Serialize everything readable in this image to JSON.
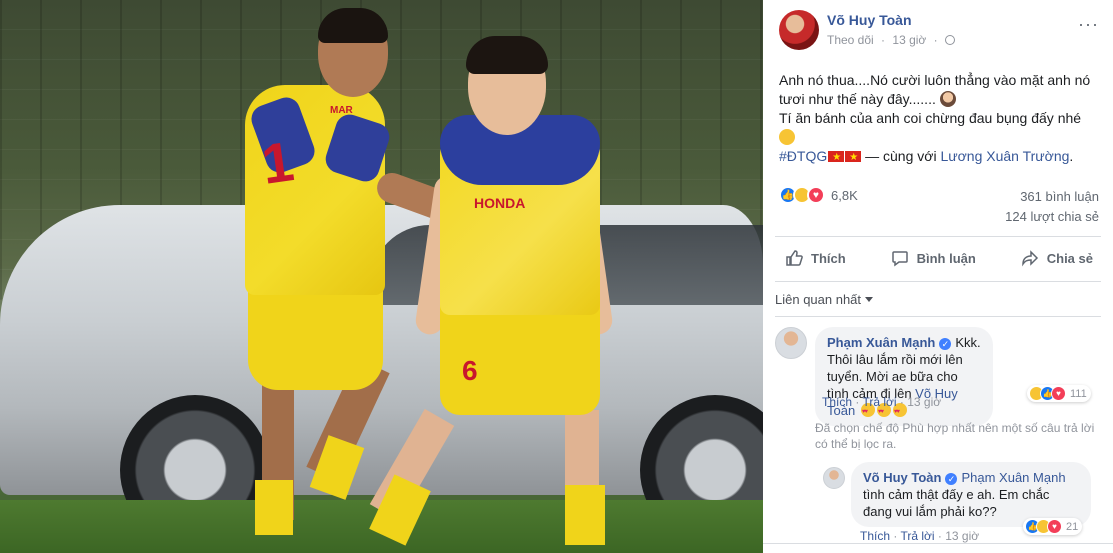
{
  "post": {
    "author": "Võ Huy Toàn",
    "follow_label": "Theo dõi",
    "time": "13 giờ",
    "more_label": "···",
    "text_line1": "Anh nó thua....Nó cười luôn thẳng vào mặt anh nó tươi như thế này đây.......",
    "text_line2": "Tí ăn bánh của anh coi chừng đau bụng đấy nhé",
    "hashtag": "#ĐTQG",
    "with_text": " — cùng với ",
    "tagged_person": "Lương Xuân Trường",
    "period": ".",
    "photo_jersey_number": "1",
    "photo_shorts_number": "6",
    "photo_brand": "HONDA",
    "photo_sleeve_text": "MAR"
  },
  "stats": {
    "reaction_count": "6,8K",
    "comments": "361 bình luận",
    "shares": "124 lượt chia sẻ"
  },
  "actions": {
    "like": "Thích",
    "comment": "Bình luận",
    "share": "Chia sẻ"
  },
  "sort_label": "Liên quan nhất",
  "comments": [
    {
      "author": "Phạm Xuân Mạnh",
      "text": "Kkk. Thôi lâu lắm rồi mới lên tuyển. Mời ae bữa cho tình cảm đi lên ",
      "mention": "Võ Huy Toàn",
      "reaction_count": "111",
      "like_label": "Thích",
      "reply_label": "Trả lời",
      "time": "13 giờ"
    },
    {
      "author": "Võ Huy Toàn",
      "mention": "Phạm Xuân Mạnh",
      "text": "tình cảm thật đấy e ah. Em chắc đang vui lắm phải ko??",
      "reaction_count": "21",
      "like_label": "Thích",
      "reply_label": "Trả lời",
      "time": "13 giờ"
    }
  ],
  "filter_notice": "Đã chọn chế độ Phù hợp nhất nên một số câu trả lời có thể bị lọc ra.",
  "colors": {
    "link": "#385898",
    "muted": "#90949c",
    "bubble": "#f2f3f5",
    "jersey_yellow": "#f0d41a",
    "jersey_blue": "#2c3f9e"
  }
}
